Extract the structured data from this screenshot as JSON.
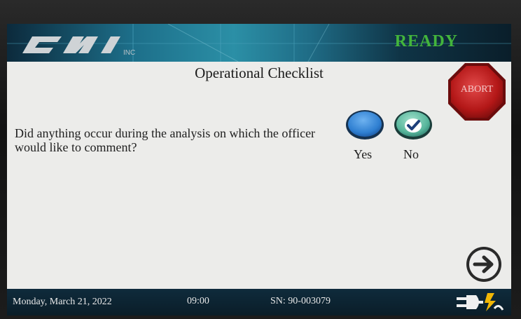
{
  "header": {
    "logo_text": "CMI INC",
    "status": "READY"
  },
  "page": {
    "title": "Operational Checklist",
    "question": "Did anything occur during the analysis on which the officer would like to comment?"
  },
  "buttons": {
    "abort_label": "ABORT",
    "yes_label": "Yes",
    "no_label": "No",
    "selected": "No"
  },
  "footer": {
    "date": "Monday, March 21, 2022",
    "time": "09:00",
    "serial": "SN: 90-003079"
  },
  "icons": {
    "abort": "stop-sign-icon",
    "next": "arrow-right-circle-icon",
    "power": "ac-power-plug-icon"
  },
  "colors": {
    "status_green": "#43b53c",
    "radio_blue": "#2f7fd1",
    "check_teal": "#57b59b",
    "abort_red": "#c41f1f",
    "bar_dark": "#0f2b3c"
  }
}
